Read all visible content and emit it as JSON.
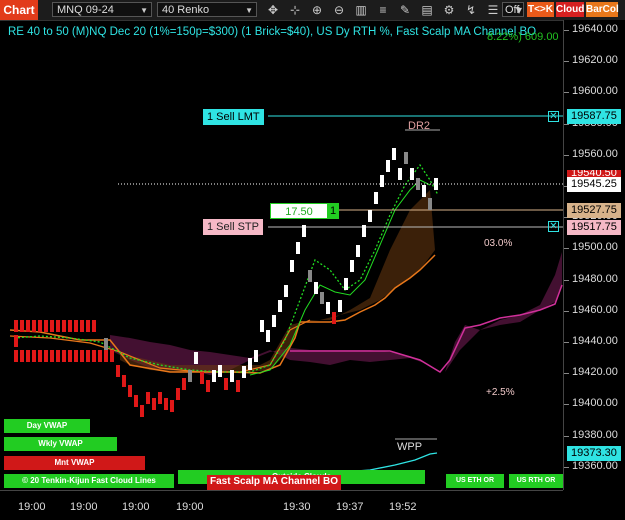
{
  "toolbar": {
    "tab_label": "Chart",
    "instrument": "MNQ 09-24",
    "period": "40 Renko",
    "toggle_value": "Off",
    "buttons": [
      {
        "label": "T<>K",
        "color": "#e85a1a"
      },
      {
        "label": "Cloud",
        "color": "#d62020"
      },
      {
        "label": "BarCol",
        "color": "#e8771a"
      }
    ],
    "icons": [
      "cursor-icon",
      "zoom-in-icon",
      "zoom-out-icon",
      "bars-icon",
      "chart-type-icon",
      "draw-icon",
      "template-icon",
      "properties-icon",
      "indicators-icon",
      "strategy-icon",
      "trade-icon",
      "data-box-icon"
    ]
  },
  "headline": {
    "text": "RE 40 to 50 (M)NQ Dec 20 (1%=150p=$300) (1 Brick=$40), US Dy RTH %, Fast Scalp MA Channel BO",
    "right": "8.22%) 609.00"
  },
  "y_axis": {
    "ticks": [
      "19640.00",
      "19620.00",
      "19600.00",
      "19580.00",
      "19560.00",
      "19540.00",
      "19520.00",
      "19500.00",
      "19480.00",
      "19460.00",
      "19440.00",
      "19420.00",
      "19400.00",
      "19380.00",
      "19360.00"
    ]
  },
  "x_axis": {
    "ticks": [
      "19:00",
      "19:00",
      "19:00",
      "19:00",
      "19:30",
      "19:37",
      "19:52"
    ]
  },
  "price_tags": {
    "sell_lmt": "19587.75",
    "current": "19545.25",
    "hidden": "19540.50",
    "entry": "19527.75",
    "sell_stp": "19517.75",
    "bottom": "19373.30"
  },
  "orders": {
    "sell_lmt_label": "1 Sell LMT",
    "sell_stp_label": "1 Sell STP",
    "position_value": "17.50",
    "position_qty": "1"
  },
  "labels": {
    "dr2": "DR2",
    "wpp": "WPP",
    "pct_top": "03.0%",
    "pct_bottom": "+2.5%"
  },
  "bottom_buttons": {
    "day_vwap": "Day VWAP",
    "wkly_vwap": "Wkly VWAP",
    "mnt_vwap": "Mnt VWAP",
    "tenkan": "Tenkin-Kijun Fast Cloud Lines",
    "copyright": "© 20",
    "outside_clouds": "Outside Clouds",
    "fast_scalp": "Fast Scalp MA Channel BO",
    "us_eth": "US ETH OR",
    "us_rth": "US RTH OR"
  },
  "colors": {
    "up_brick": "#ffffff",
    "down_brick": "#e01818",
    "gray_brick": "#888888",
    "cyan": "#2fe3e3",
    "green": "#22cc22",
    "orange": "#e8771a",
    "cloud": "#5a1840"
  }
}
